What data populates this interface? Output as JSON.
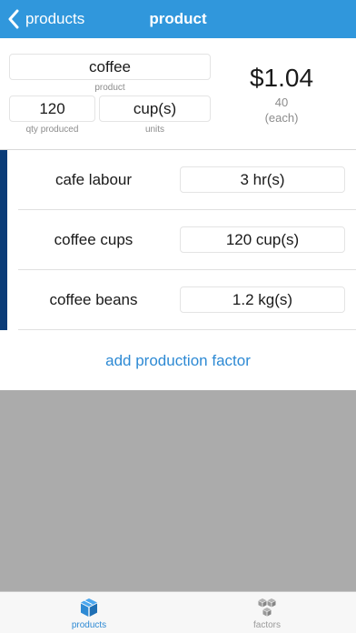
{
  "nav": {
    "back_label": "products",
    "title": "product"
  },
  "product": {
    "name": "coffee",
    "name_caption": "product",
    "qty": "120",
    "qty_caption": "qty produced",
    "units": "cup(s)",
    "units_caption": "units",
    "price": "$1.04",
    "price_basis": "40",
    "price_each": "(each)"
  },
  "factors": [
    {
      "name": "cafe labour",
      "qty": "3 hr(s)"
    },
    {
      "name": "coffee cups",
      "qty": "120 cup(s)"
    },
    {
      "name": "coffee beans",
      "qty": "1.2 kg(s)"
    }
  ],
  "add_factor_label": "add production factor",
  "tabs": [
    {
      "label": "products",
      "icon": "box-icon",
      "active": true
    },
    {
      "label": "factors",
      "icon": "boxes-icon",
      "active": false
    }
  ],
  "colors": {
    "nav_bg": "#3097dc",
    "accent": "#2e8ad4",
    "factor_bar": "#0b3c78",
    "tab_inactive": "#9a9a9a"
  }
}
